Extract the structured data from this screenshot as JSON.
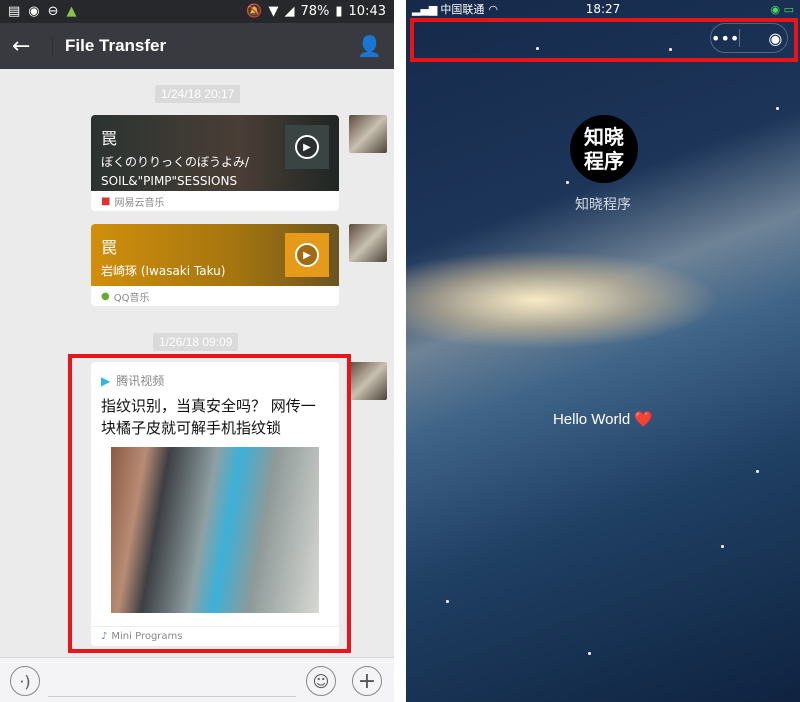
{
  "left": {
    "status_bar": {
      "battery": "78%",
      "time": "10:43"
    },
    "nav": {
      "title": "File Transfer"
    },
    "timestamps": [
      "1/24/18 20:17",
      "1/26/18 09:09"
    ],
    "messages": [
      {
        "title": "罠",
        "subtitle1": "ぼくのりりっくのぼうよみ/",
        "subtitle2": "SOIL&\"PIMP\"SESSIONS",
        "source": "网易云音乐"
      },
      {
        "title": "罠",
        "subtitle1": "岩崎琢 (Iwasaki Taku)",
        "source": "QQ音乐"
      },
      {
        "app": "腾讯视频",
        "title": "指纹识别，当真安全吗？ 网传一块橘子皮就可解手机指纹锁",
        "source": "Mini Programs"
      }
    ]
  },
  "right": {
    "status_bar": {
      "carrier": "中国联通",
      "time": "18:27"
    },
    "logo_text": "知晓程序",
    "app_name": "知晓程序",
    "hello": "Hello World",
    "heart": "❤️"
  },
  "colors": {
    "highlight": "#e8141a",
    "nav": "#393a3f",
    "qq_card": "#c98a0a"
  }
}
